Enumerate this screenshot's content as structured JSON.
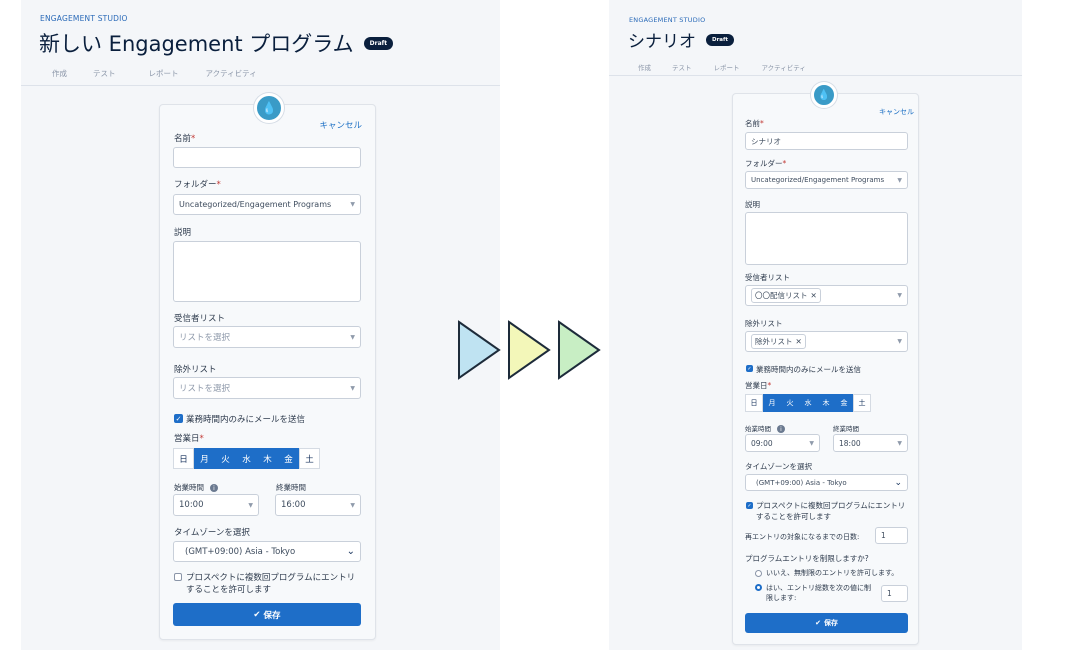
{
  "left": {
    "studio": "ENGAGEMENT STUDIO",
    "title": "新しい Engagement プログラム",
    "badge": "Draft",
    "tabs": [
      "作成",
      "テスト",
      "レポート",
      "アクティビティ"
    ],
    "cancel": "キャンセル",
    "name_label": "名前",
    "folder_label": "フォルダー",
    "folder_value": "Uncategorized/Engagement Programs",
    "desc_label": "説明",
    "recipient_label": "受信者リスト",
    "recipient_placeholder": "リストを選択",
    "exclusion_label": "除外リスト",
    "exclusion_placeholder": "リストを選択",
    "business_hours_label": "業務時間内のみにメールを送信",
    "business_days_label": "営業日",
    "days": [
      "日",
      "月",
      "火",
      "水",
      "木",
      "金",
      "土"
    ],
    "days_on": [
      false,
      true,
      true,
      true,
      true,
      true,
      false
    ],
    "start_label": "始業時間",
    "start_value": "10:00",
    "end_label": "終業時間",
    "end_value": "16:00",
    "tz_label": "タイムゾーンを選択",
    "tz_value": "(GMT+09:00) Asia - Tokyo",
    "multi_entry_label_1": "プロスペクトに複数回プログラムにエントリ",
    "multi_entry_label_2": "することを許可します",
    "save": "保存"
  },
  "right": {
    "studio": "ENGAGEMENT STUDIO",
    "title": "シナリオ",
    "badge": "Draft",
    "tabs": [
      "作成",
      "テスト",
      "レポート",
      "アクティビティ"
    ],
    "cancel": "キャンセル",
    "name_label": "名前",
    "name_value": "シナリオ",
    "folder_label": "フォルダー",
    "folder_value": "Uncategorized/Engagement Programs",
    "desc_label": "説明",
    "recipient_label": "受信者リスト",
    "recipient_value": "〇〇配信リスト",
    "exclusion_label": "除外リスト",
    "exclusion_value": "除外リスト",
    "business_hours_label": "業務時間内のみにメールを送信",
    "business_days_label": "営業日",
    "days": [
      "日",
      "月",
      "火",
      "水",
      "木",
      "金",
      "土"
    ],
    "days_on": [
      false,
      true,
      true,
      true,
      true,
      true,
      false
    ],
    "start_label": "始業時間",
    "start_value": "09:00",
    "end_label": "終業時間",
    "end_value": "18:00",
    "tz_label": "タイムゾーンを選択",
    "tz_value": "(GMT+09:00) Asia - Tokyo",
    "multi_entry_label_1": "プロスペクトに複数回プログラムにエントリ",
    "multi_entry_label_2": "することを許可します",
    "reentry_label": "再エントリの対象になるまでの日数:",
    "reentry_value": "1",
    "limit_label": "プログラムエントリを制限しますか?",
    "limit_no": "いいえ、無制限のエントリを許可します。",
    "limit_yes_1": "はい、エントリ総数を次の値に制",
    "limit_yes_2": "限します:",
    "limit_value": "1",
    "save": "保存"
  },
  "colors": {
    "arrow1": "#bfe3f2",
    "arrow2": "#f3f7b9",
    "arrow3": "#c8eec4",
    "accent": "#1e6ec8"
  }
}
